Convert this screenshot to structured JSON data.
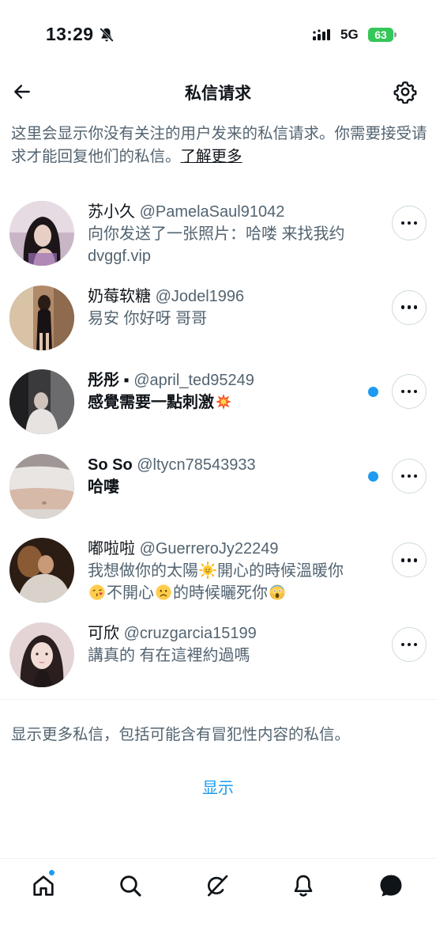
{
  "status_bar": {
    "time": "13:29",
    "network": "5G",
    "battery": "63"
  },
  "header": {
    "title": "私信请求"
  },
  "intro": {
    "text": "这里会显示你没有关注的用户发来的私信请求。你需要接受请求才能回复他们的私信。",
    "learn_more": "了解更多"
  },
  "messages": [
    {
      "name": "苏小久",
      "handle": "@PamelaSaul91042",
      "text": "向你发送了一张照片：哈喽 来找我约 dvggf.vip",
      "unread": false
    },
    {
      "name": "奶莓软糖",
      "handle": "@Jodel1996",
      "text": "易安 你好呀 哥哥",
      "unread": false
    },
    {
      "name": "彤彤 ▪︎",
      "handle": "@april_ted95249",
      "text": "感覺需要一點刺激",
      "unread": true
    },
    {
      "name": "So So",
      "handle": "@ltycn78543933",
      "text": "哈嘍",
      "unread": true
    },
    {
      "name": "嘟啦啦",
      "handle": "@GuerreroJy22249",
      "text_parts": [
        "我想做你的太陽",
        "開心的時候溫暖你",
        "不開心",
        "的時候曬死你"
      ],
      "unread": false
    },
    {
      "name": "可欣",
      "handle": "@cruzgarcia15199",
      "text": "講真的 有在這裡約過嗎",
      "unread": false
    }
  ],
  "footer": {
    "show_more_text": "显示更多私信，包括可能含有冒犯性内容的私信。",
    "show_label": "显示"
  },
  "nav": {
    "items": [
      "home-icon",
      "search-icon",
      "grok-icon",
      "notifications-icon",
      "messages-icon"
    ]
  },
  "colors": {
    "accent": "#1d9bf0",
    "text": "#0f1419",
    "secondary": "#536471"
  }
}
